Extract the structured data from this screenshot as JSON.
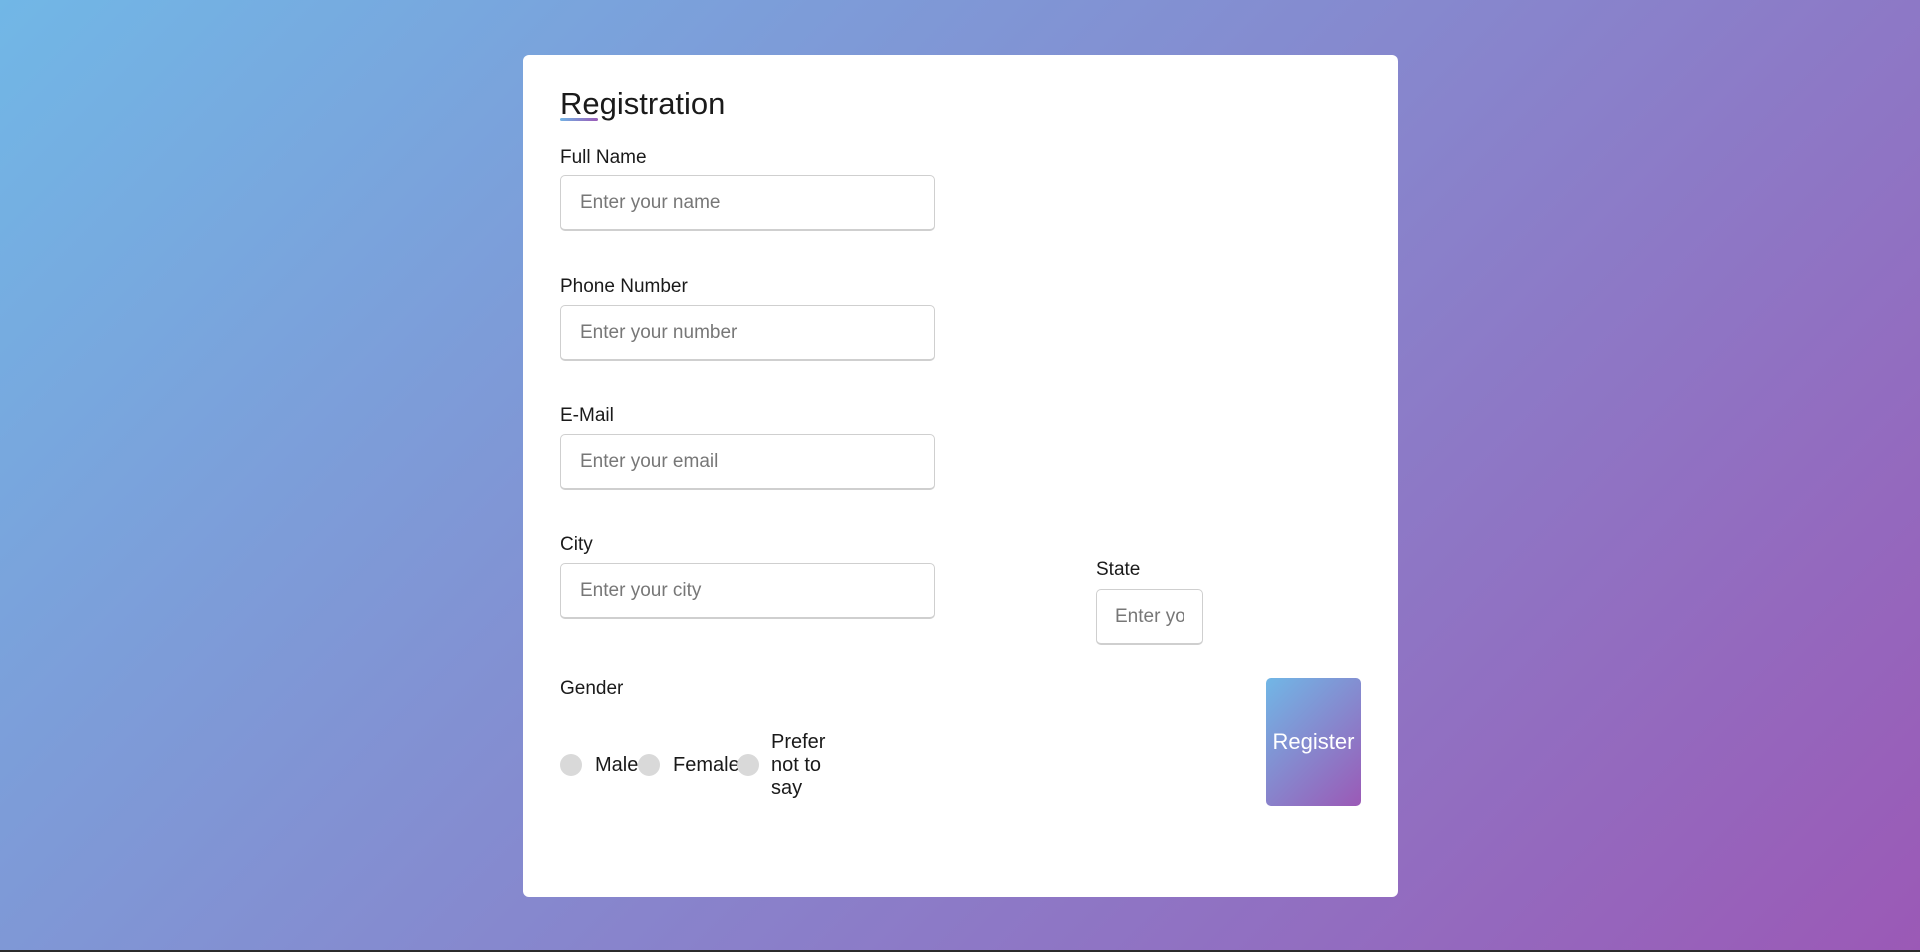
{
  "form": {
    "title": "Registration",
    "fields": {
      "full_name": {
        "label": "Full Name",
        "placeholder": "Enter your name",
        "value": ""
      },
      "phone": {
        "label": "Phone Number",
        "placeholder": "Enter your number",
        "value": ""
      },
      "email": {
        "label": "E-Mail",
        "placeholder": "Enter your email",
        "value": ""
      },
      "city": {
        "label": "City",
        "placeholder": "Enter your city",
        "value": ""
      },
      "state": {
        "label": "State",
        "placeholder": "Enter your state",
        "value": ""
      }
    },
    "gender": {
      "label": "Gender",
      "options": [
        "Male",
        "Female",
        "Prefer not to say"
      ]
    },
    "register_label": "Register"
  },
  "colors": {
    "gradient_start": "#71b7e6",
    "gradient_end": "#9b59b6",
    "card_background": "#ffffff"
  }
}
